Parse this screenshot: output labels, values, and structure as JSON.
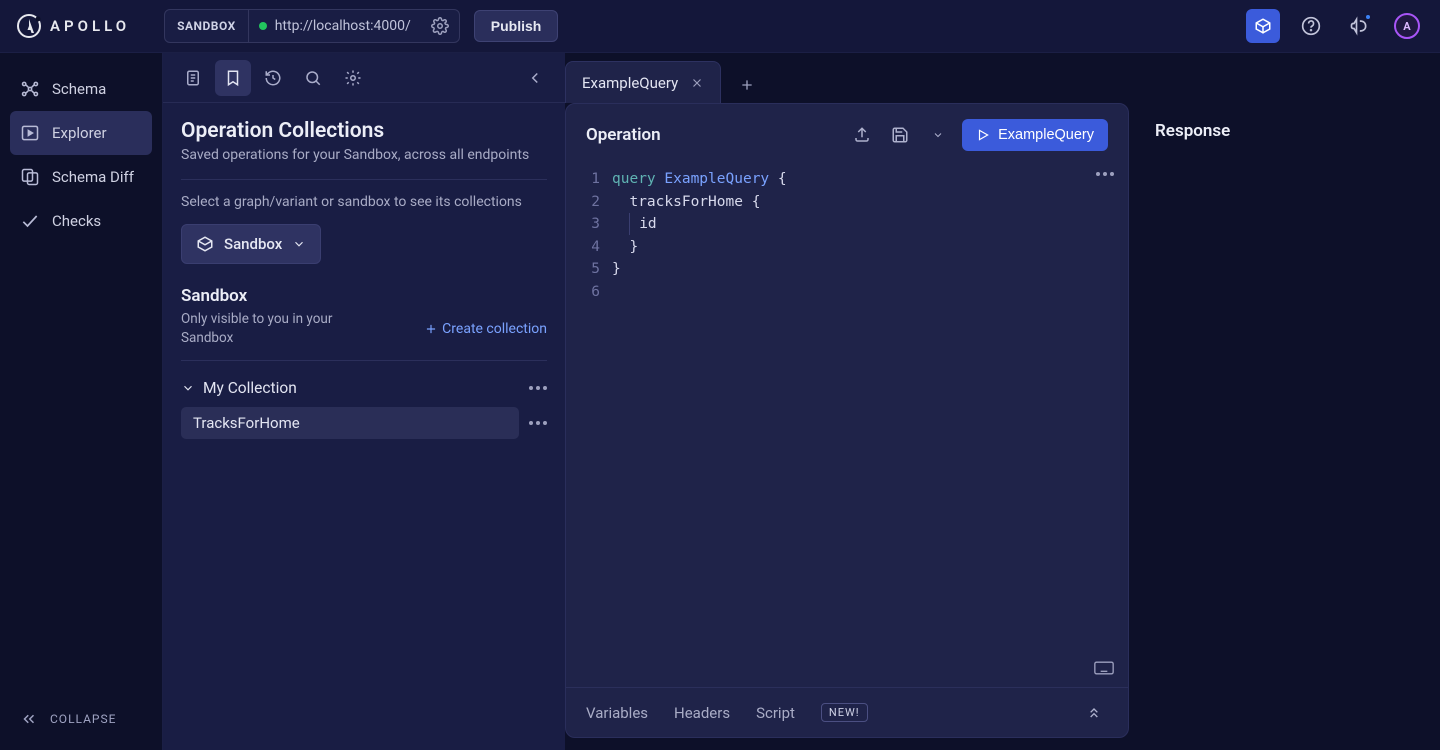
{
  "brand": {
    "name": "APOLLO",
    "avatar_initial": "A"
  },
  "topbar": {
    "sandbox_badge": "SANDBOX",
    "url": "http://localhost:4000/",
    "publish_label": "Publish"
  },
  "leftnav": {
    "items": [
      {
        "label": "Schema"
      },
      {
        "label": "Explorer"
      },
      {
        "label": "Schema Diff"
      },
      {
        "label": "Checks"
      }
    ],
    "collapse_label": "COLLAPSE"
  },
  "collections": {
    "title": "Operation Collections",
    "subtitle": "Saved operations for your Sandbox, across all endpoints",
    "hint": "Select a graph/variant or sandbox to see its collections",
    "scope_button": "Sandbox",
    "section_title": "Sandbox",
    "section_subtitle": "Only visible to you in your Sandbox",
    "create_label": "Create collection",
    "collection_name": "My Collection",
    "operation_item": "TracksForHome"
  },
  "tabs": {
    "active": "ExampleQuery"
  },
  "operation_panel": {
    "title": "Operation",
    "run_label": "ExampleQuery",
    "footer": {
      "variables": "Variables",
      "headers": "Headers",
      "script": "Script",
      "new_badge": "NEW!"
    },
    "code": {
      "line_numbers": [
        "1",
        "2",
        "3",
        "4",
        "5",
        "6"
      ],
      "kw_query": "query",
      "op_name": "ExampleQuery",
      "field_tracks": "tracksForHome",
      "field_id": "id"
    }
  },
  "response_panel": {
    "title": "Response"
  }
}
